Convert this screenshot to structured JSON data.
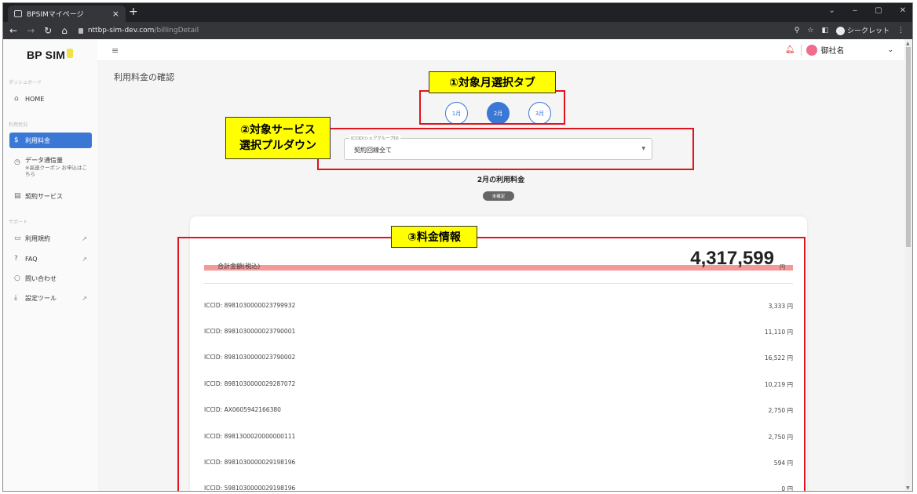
{
  "browser": {
    "tab_title": "BPSIMマイページ",
    "tab_close": "×",
    "new_tab": "+",
    "win_min": "‒",
    "win_max": "▢",
    "win_close": "✕",
    "win_menu": "⌄",
    "url_host": "nttbp-sim-dev.com",
    "url_path": "/billingDetail",
    "incognito_label": "シークレット"
  },
  "sidebar": {
    "logo": "BP SIM",
    "section_dashboard": "ダッシュボード",
    "home": "HOME",
    "section_usage": "利用状況",
    "billing": "利用料金",
    "data_usage": "データ通信量",
    "data_usage_sub": "※高速クーポン お申込はこちら",
    "contract_services": "契約サービス",
    "section_support": "サポート",
    "terms": "利用規約",
    "faq": "FAQ",
    "contact": "問い合わせ",
    "settings_tool": "設定ツール"
  },
  "header": {
    "user_name": "御社名"
  },
  "main": {
    "page_title": "利用料金の確認",
    "month_tabs": [
      "1月",
      "2月",
      "3月"
    ],
    "selected_month_index": 1,
    "select_label": "ICCID/シェアグループID",
    "select_value": "契約回線全て",
    "month_heading": "2月の利用料金",
    "status_badge": "未確定",
    "total_label": "合計金額(税込)",
    "total_amount": "4,317,599",
    "currency": "円",
    "rows": [
      {
        "id": "ICCID: 8981030000023799932",
        "amount": "3,333 円"
      },
      {
        "id": "ICCID: 8981030000023790001",
        "amount": "11,110 円"
      },
      {
        "id": "ICCID: 8981030000023790002",
        "amount": "16,522 円"
      },
      {
        "id": "ICCID: 8981030000029287072",
        "amount": "10,219 円"
      },
      {
        "id": "ICCID: AX0605942166380",
        "amount": "2,750 円"
      },
      {
        "id": "ICCID: 8981300020000000111",
        "amount": "2,750 円"
      },
      {
        "id": "ICCID: 8981030000029198196",
        "amount": "594 円"
      },
      {
        "id": "ICCID: 5981030000029198196",
        "amount": "0 円"
      }
    ]
  },
  "annotations": {
    "a1": "①対象月選択タブ",
    "a2_line1": "②対象サービス",
    "a2_line2": "選択プルダウン",
    "a3": "③料金情報",
    "color": "#e0141e",
    "label_bg": "#ffff00"
  },
  "colors": {
    "accent": "#3b78d6",
    "total_highlight": "#f59898"
  }
}
